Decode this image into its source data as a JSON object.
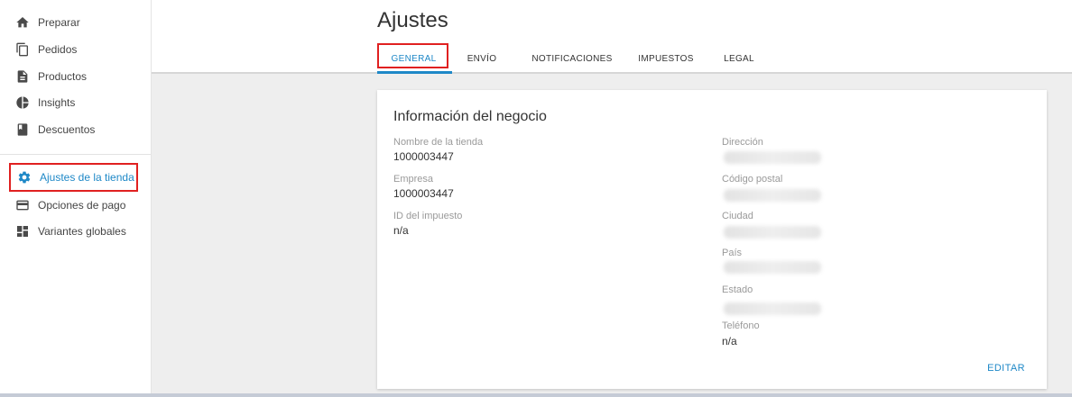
{
  "sidebar": {
    "items": [
      {
        "label": "Preparar",
        "icon": "home-icon"
      },
      {
        "label": "Pedidos",
        "icon": "copy-icon"
      },
      {
        "label": "Productos",
        "icon": "document-icon"
      },
      {
        "label": "Insights",
        "icon": "pie-chart-icon"
      },
      {
        "label": "Descuentos",
        "icon": "bookmark-icon"
      },
      {
        "label": "Ajustes de la tienda",
        "icon": "gear-icon",
        "active": true
      },
      {
        "label": "Opciones de pago",
        "icon": "credit-card-icon"
      },
      {
        "label": "Variantes globales",
        "icon": "dashboard-icon"
      }
    ]
  },
  "header": {
    "title": "Ajustes",
    "tabs": [
      {
        "label": "GENERAL",
        "active": true
      },
      {
        "label": "ENVÍO"
      },
      {
        "label": "NOTIFICACIONES"
      },
      {
        "label": "IMPUESTOS"
      },
      {
        "label": "LEGAL"
      }
    ]
  },
  "card": {
    "title": "Información del negocio",
    "left_fields": [
      {
        "label": "Nombre de la tienda",
        "value": "1000003447"
      },
      {
        "label": "Empresa",
        "value": "1000003447"
      },
      {
        "label": "ID del impuesto",
        "value": "n/a"
      }
    ],
    "right_fields": [
      {
        "label": "Dirección"
      },
      {
        "label": "Código postal"
      },
      {
        "label": "Ciudad"
      },
      {
        "label": "País"
      },
      {
        "label": "Estado"
      },
      {
        "label": "Teléfono",
        "value": "n/a"
      }
    ],
    "edit_label": "EDITAR"
  },
  "colors": {
    "accent": "#1e88c7",
    "highlight": "#e02020"
  }
}
